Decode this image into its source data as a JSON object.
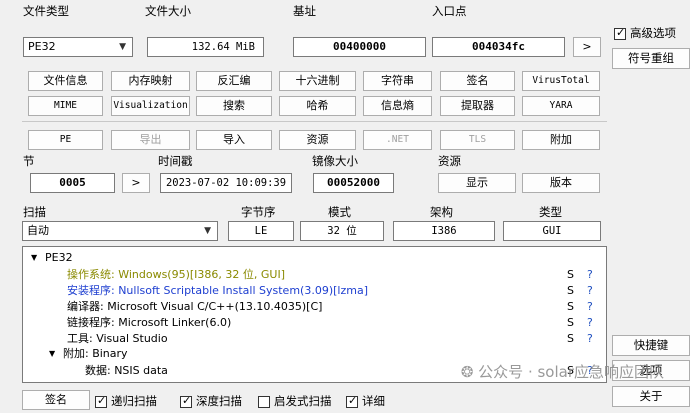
{
  "top": {
    "filetype_label": "文件类型",
    "filesize_label": "文件大小",
    "base_label": "基址",
    "entry_label": "入口点",
    "filetype_value": "PE32",
    "filesize_value": "132.64 MiB",
    "base_value": "00400000",
    "entry_value": "004034fc",
    "entry_go": ">"
  },
  "right": {
    "advanced_label": "高级选项",
    "advanced_checked": true,
    "symbol_button": "符号重组",
    "shortcut_button": "快捷键",
    "options_button": "选项",
    "about_button": "关于"
  },
  "toolbar1": [
    "文件信息",
    "内存映射",
    "反汇编",
    "十六进制",
    "字符串",
    "签名",
    "VirusTotal"
  ],
  "toolbar2": [
    "MIME",
    "Visualization",
    "搜索",
    "哈希",
    "信息熵",
    "提取器",
    "YARA"
  ],
  "toolbar3": [
    "PE",
    "导出",
    "导入",
    "资源",
    ".NET",
    "TLS",
    "附加"
  ],
  "sections": {
    "section_label": "节",
    "timestamp_label": "时间戳",
    "imagesize_label": "镜像大小",
    "resource_label": "资源",
    "section_value": "0005",
    "section_go": ">",
    "timestamp_value": "2023-07-02 10:09:39",
    "imagesize_value": "00052000",
    "show_button": "显示",
    "version_button": "版本"
  },
  "scan": {
    "scan_label": "扫描",
    "endian_label": "字节序",
    "mode_label": "模式",
    "arch_label": "架构",
    "type_label": "类型",
    "scan_value": "自动",
    "endian_value": "LE",
    "mode_value": "32 位",
    "arch_value": "I386",
    "type_value": "GUI"
  },
  "tree": {
    "root": "PE32",
    "rows": [
      {
        "text": "操作系统: Windows(95)[I386, 32 位, GUI]",
        "color": "#8a8a00",
        "s": "S",
        "q": "?"
      },
      {
        "text": "安装程序: Nullsoft Scriptable Install System(3.09)[lzma]",
        "color": "#1e3fd0",
        "s": "S",
        "q": "?"
      },
      {
        "text": "编译器: Microsoft Visual C/C++(13.10.4035)[C]",
        "color": "#000000",
        "s": "S",
        "q": "?"
      },
      {
        "text": "链接程序: Microsoft Linker(6.0)",
        "color": "#000000",
        "s": "S",
        "q": "?"
      },
      {
        "text": "工具: Visual Studio",
        "color": "#000000",
        "s": "S",
        "q": "?"
      }
    ],
    "overlay_node": "附加: Binary",
    "overlay_child": {
      "text": "数据: NSIS data",
      "s": "S",
      "q": "?"
    }
  },
  "bottom": {
    "signature_label": "签名",
    "recursive_label": "递归扫描",
    "deep_label": "深度扫描",
    "heuristic_label": "启发式扫描",
    "verbose_label": "详细"
  },
  "watermark": "公众号 · solar应急响应团队"
}
